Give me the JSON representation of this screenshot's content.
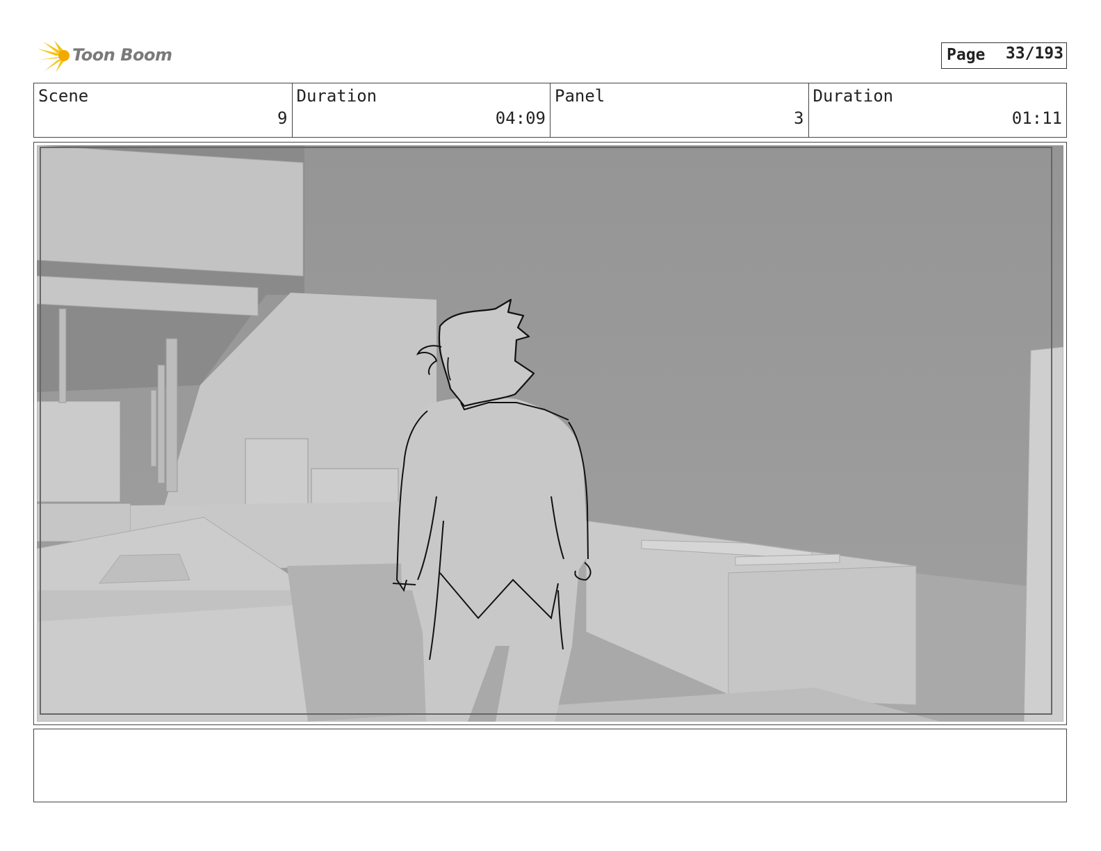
{
  "header": {
    "logo_text": "Toon Boom",
    "page_label": "Page",
    "page_value": "33/193"
  },
  "info": {
    "scene_label": "Scene",
    "scene_value": "9",
    "scene_duration_label": "Duration",
    "scene_duration_value": "04:09",
    "panel_label": "Panel",
    "panel_value": "3",
    "panel_duration_label": "Duration",
    "panel_duration_value": "01:11"
  },
  "notes": {
    "text": ""
  },
  "colors": {
    "logo_yellow": "#f5c518",
    "logo_text": "#7a7a7a",
    "background_wall": "#9a9a9a",
    "set_light": "#c6c6c6"
  }
}
